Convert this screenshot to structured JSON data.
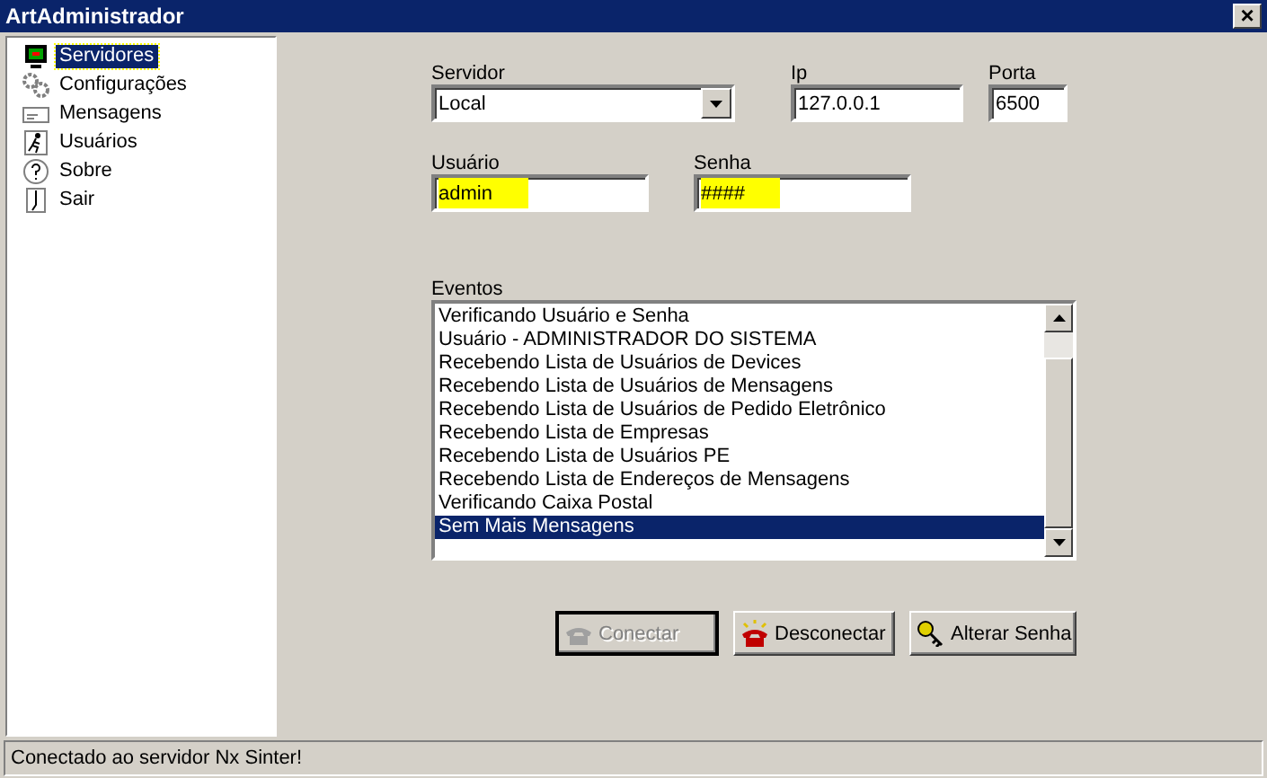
{
  "window": {
    "title": "ArtAdministrador",
    "close": "×"
  },
  "tree": [
    {
      "label": "Servidores",
      "kind": "monitor",
      "selected": true
    },
    {
      "label": "Configurações",
      "kind": "gears",
      "selected": false
    },
    {
      "label": "Mensagens",
      "kind": "envelope",
      "selected": false
    },
    {
      "label": "Usuários",
      "kind": "person",
      "selected": false
    },
    {
      "label": "Sobre",
      "kind": "question",
      "selected": false
    },
    {
      "label": "Sair",
      "kind": "door",
      "selected": false
    }
  ],
  "servidor": {
    "label": "Servidor",
    "value": "Local"
  },
  "ip": {
    "label": "Ip",
    "value": "127.0.0.1"
  },
  "porta": {
    "label": "Porta",
    "value": "6500"
  },
  "usuario": {
    "label": "Usuário",
    "value": "admin",
    "highlighted": true
  },
  "senha": {
    "label": "Senha",
    "value": "####",
    "highlighted": true
  },
  "eventos": {
    "label": "Eventos",
    "items": [
      {
        "text": "Verificando Usuário e Senha",
        "selected": false
      },
      {
        "text": "Usuário - ADMINISTRADOR DO SISTEMA",
        "selected": false
      },
      {
        "text": "Recebendo Lista de Usuários de Devices",
        "selected": false
      },
      {
        "text": "Recebendo Lista de Usuários de Mensagens",
        "selected": false
      },
      {
        "text": "Recebendo Lista de Usuários de Pedido Eletrônico",
        "selected": false
      },
      {
        "text": "Recebendo Lista de Empresas",
        "selected": false
      },
      {
        "text": "Recebendo Lista de Usuários PE",
        "selected": false
      },
      {
        "text": "Recebendo Lista de Endereços de Mensagens",
        "selected": false
      },
      {
        "text": "Verificando Caixa Postal",
        "selected": false
      },
      {
        "text": "Sem Mais Mensagens",
        "selected": true
      }
    ]
  },
  "buttons": [
    {
      "label": "Conectar",
      "kind": "phone",
      "disabled": true
    },
    {
      "label": "Desconectar",
      "kind": "ringing",
      "disabled": false
    },
    {
      "label": "Alterar Senha",
      "kind": "key",
      "disabled": false
    }
  ],
  "status_bar": "Conectado ao servidor Nx Sinter!"
}
